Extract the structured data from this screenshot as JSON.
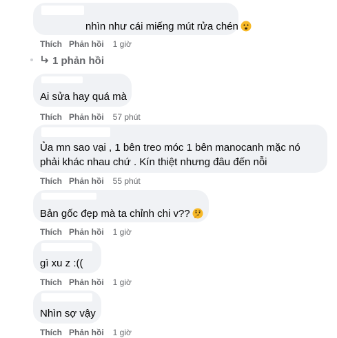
{
  "comments": [
    {
      "text": "nhìn như cái miếng mút rửa chén",
      "emoji": "sad-face-emoji",
      "like_label": "Thích",
      "reply_label": "Phản hồi",
      "time": "1 giờ"
    },
    {
      "text": "Ai sửa hay quá mà",
      "like_label": "Thích",
      "reply_label": "Phản hồi",
      "time": "57 phút"
    },
    {
      "text_line1": "Ủa mn sao vại , 1 bên treo móc 1 bên manocanh mặc nó",
      "text_line2": "phải khác nhau chứ . Kín thiệt nhưng đâu đến nỗi",
      "like_label": "Thích",
      "reply_label": "Phản hồi",
      "time": "55 phút"
    },
    {
      "text": "Bản gốc đẹp mà ta chỉnh chi v??",
      "emoji": "thinking-face-emoji",
      "like_label": "Thích",
      "reply_label": "Phản hồi",
      "time": "1 giờ"
    },
    {
      "text": "gì xu z :((",
      "like_label": "Thích",
      "reply_label": "Phản hồi",
      "time": "1 giờ"
    },
    {
      "text": "Nhìn sợ vậy",
      "like_label": "Thích",
      "reply_label": "Phản hồi",
      "time": "1 giờ"
    }
  ],
  "replies_link": "1 phản hồi",
  "colors": {
    "bubble": "#f0f2f5",
    "text": "#050505",
    "meta": "#65676b",
    "emoji": "#f7b928"
  }
}
